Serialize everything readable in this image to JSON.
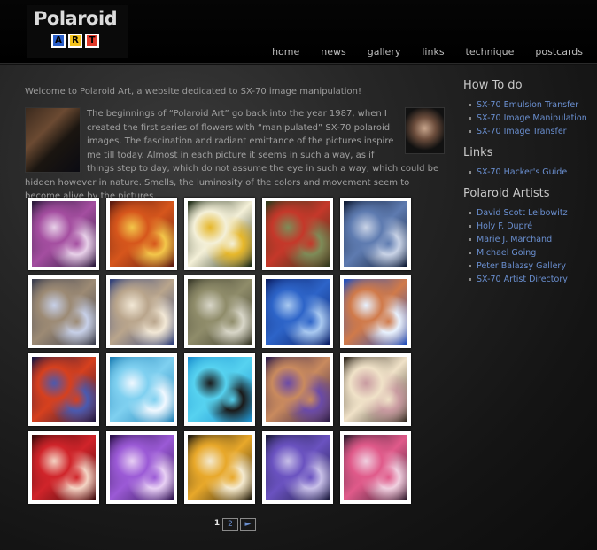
{
  "header": {
    "logo_title": "Polaroid",
    "logo_tiles": [
      {
        "letter": "A",
        "color": "#2a5fc9"
      },
      {
        "letter": "R",
        "color": "#f2c21b"
      },
      {
        "letter": "T",
        "color": "#e23a2a"
      }
    ],
    "nav": [
      "home",
      "news",
      "gallery",
      "links",
      "technique",
      "postcards"
    ]
  },
  "content": {
    "welcome": "Welcome to Polaroid Art, a website dedicated to SX-70 image manipulation!",
    "intro": "The beginnings of “Polaroid Art” go back into the year 1987, when I created the first series of flowers with “manipulated” SX-70 polaroid images. The fascination and radiant emittance of the pictures inspire me till today. Almost in each picture it seems in such a way, as if things step to day, which do not assume the eye in such a way, which could be hidden however in nature. Smells, the luminosity of the colors and movement seem to become alive by the pictures."
  },
  "gallery": [
    {
      "name": "purple-flowers",
      "colors": [
        "#2a1a3a",
        "#a44ea0",
        "#e7d0e8"
      ]
    },
    {
      "name": "orange-flowers",
      "colors": [
        "#5a1a10",
        "#d6561c",
        "#f3c64a"
      ]
    },
    {
      "name": "daffodils",
      "colors": [
        "#1d2a14",
        "#f4f0d8",
        "#e6b72a"
      ]
    },
    {
      "name": "red-lily",
      "colors": [
        "#2e3a1c",
        "#c5382a",
        "#7d8c58"
      ]
    },
    {
      "name": "bottles",
      "colors": [
        "#0e1a33",
        "#5e7bb0",
        "#c9d3e6"
      ]
    },
    {
      "name": "statue",
      "colors": [
        "#3a3d4e",
        "#9c8a74",
        "#c7d0e8"
      ]
    },
    {
      "name": "building",
      "colors": [
        "#2e3f7a",
        "#b9a58c",
        "#f2e8d6"
      ]
    },
    {
      "name": "orchard",
      "colors": [
        "#3a3a2a",
        "#8f8c6a",
        "#d8d6c8"
      ]
    },
    {
      "name": "blue-trees",
      "colors": [
        "#0b1f66",
        "#2d64c8",
        "#a9c9f0"
      ]
    },
    {
      "name": "pool-people",
      "colors": [
        "#1f4fbf",
        "#d07a4a",
        "#e8f2ff"
      ]
    },
    {
      "name": "red-tulips",
      "colors": [
        "#1a1640",
        "#d6401e",
        "#4a5ab0"
      ]
    },
    {
      "name": "swimmer",
      "colors": [
        "#1c7fb5",
        "#7fd0f0",
        "#f0f8ff"
      ]
    },
    {
      "name": "diver",
      "colors": [
        "#1a8fcf",
        "#56d2f0",
        "#1a1a1a"
      ]
    },
    {
      "name": "nude",
      "colors": [
        "#2a1a4a",
        "#c98a5e",
        "#6a4aa8"
      ]
    },
    {
      "name": "cactus-flowers",
      "colors": [
        "#2c241a",
        "#f0e2c8",
        "#c89aa0"
      ]
    },
    {
      "name": "red-dahlia",
      "colors": [
        "#3a0a0a",
        "#d0242a",
        "#f4d4c4"
      ]
    },
    {
      "name": "clematis",
      "colors": [
        "#2a1048",
        "#9b5ad6",
        "#e8d0f4"
      ]
    },
    {
      "name": "sunflowers",
      "colors": [
        "#1e1a10",
        "#e8a82a",
        "#f4ead0"
      ]
    },
    {
      "name": "blue-flower",
      "colors": [
        "#1a1a3a",
        "#6a52c0",
        "#c8c0e8"
      ]
    },
    {
      "name": "pink-roses",
      "colors": [
        "#2a1a2a",
        "#e05a8a",
        "#f0d0e0"
      ]
    }
  ],
  "pagination": {
    "current": "1",
    "next_page": "2",
    "next_arrow": "►"
  },
  "sidebar": {
    "howto_title": "How To do",
    "howto": [
      "SX-70 Emulsion Transfer",
      "SX-70 Image Manipulation",
      "SX-70 Image Transfer"
    ],
    "links_title": "Links",
    "links": [
      "SX-70 Hacker's Guide"
    ],
    "artists_title": "Polaroid Artists",
    "artists": [
      "David Scott Leibowitz",
      "Holy F. Dupré",
      "Marie J. Marchand",
      "Michael Going",
      "Peter Balazsy Gallery",
      "SX-70 Artist Directory"
    ]
  },
  "colors": {
    "link": "#6a8fd0",
    "heading": "#c8c8c8"
  }
}
